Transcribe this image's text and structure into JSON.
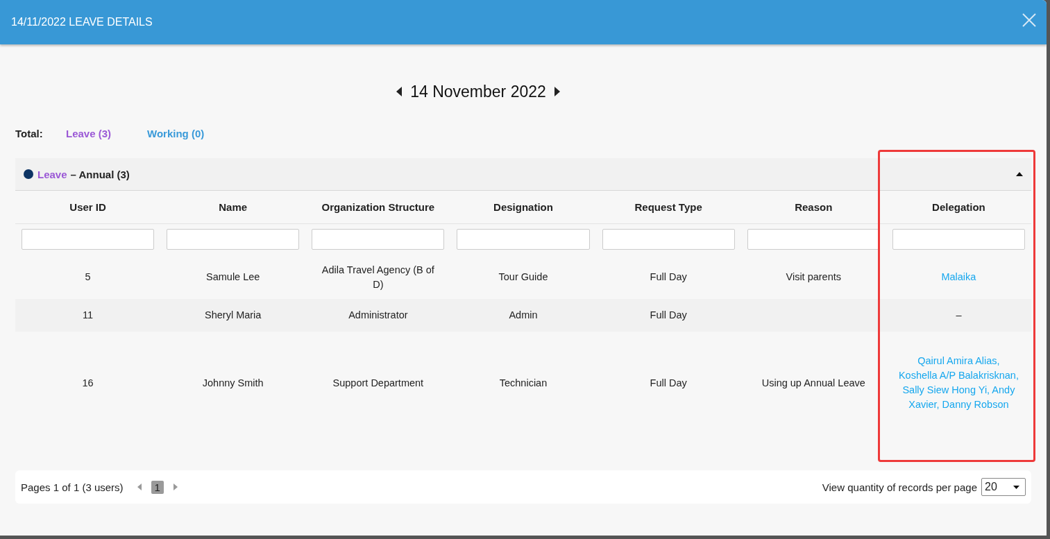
{
  "dialog": {
    "title": "14/11/2022 LEAVE DETAILS"
  },
  "date_nav": {
    "label": "14 November 2022"
  },
  "totals": {
    "label": "Total:",
    "items": [
      {
        "label": "Leave (3)",
        "color": "#9b59d6"
      },
      {
        "label": "Working (0)",
        "color": "#3a9ad9"
      }
    ]
  },
  "group": {
    "category": "Leave",
    "title": "– Annual (3)",
    "expanded": true
  },
  "table": {
    "columns": [
      {
        "label": "User ID",
        "highlighted": false
      },
      {
        "label": "Name",
        "highlighted": false
      },
      {
        "label": "Organization Structure",
        "highlighted": false
      },
      {
        "label": "Designation",
        "highlighted": false
      },
      {
        "label": "Request Type",
        "highlighted": false
      },
      {
        "label": "Reason",
        "highlighted": false
      },
      {
        "label": "Delegation",
        "highlighted": true
      }
    ],
    "rows": [
      {
        "cells": [
          "5",
          "Samule Lee",
          "Adila Travel Agency (B of D)",
          "Tour Guide",
          "Full Day",
          "Visit parents",
          "Malaika"
        ],
        "delegation_link": true
      },
      {
        "cells": [
          "11",
          "Sheryl Maria",
          "Administrator",
          "Admin",
          "Full Day",
          "",
          "–"
        ],
        "delegation_link": false
      },
      {
        "cells": [
          "16",
          "Johnny Smith",
          "Support Department",
          "Technician",
          "Full Day",
          "Using up Annual Leave",
          "Qairul Amira Alias, Koshella A/P Balakrisknan, Sally Siew Hong Yi, Andy Xavier, Danny Robson"
        ],
        "delegation_link": true
      }
    ]
  },
  "pagination": {
    "summary": "Pages 1 of 1 (3 users)",
    "pages": [
      {
        "label": "1",
        "selected": true
      }
    ],
    "per_page_label": "View quantity of records per page",
    "per_page": "20"
  }
}
